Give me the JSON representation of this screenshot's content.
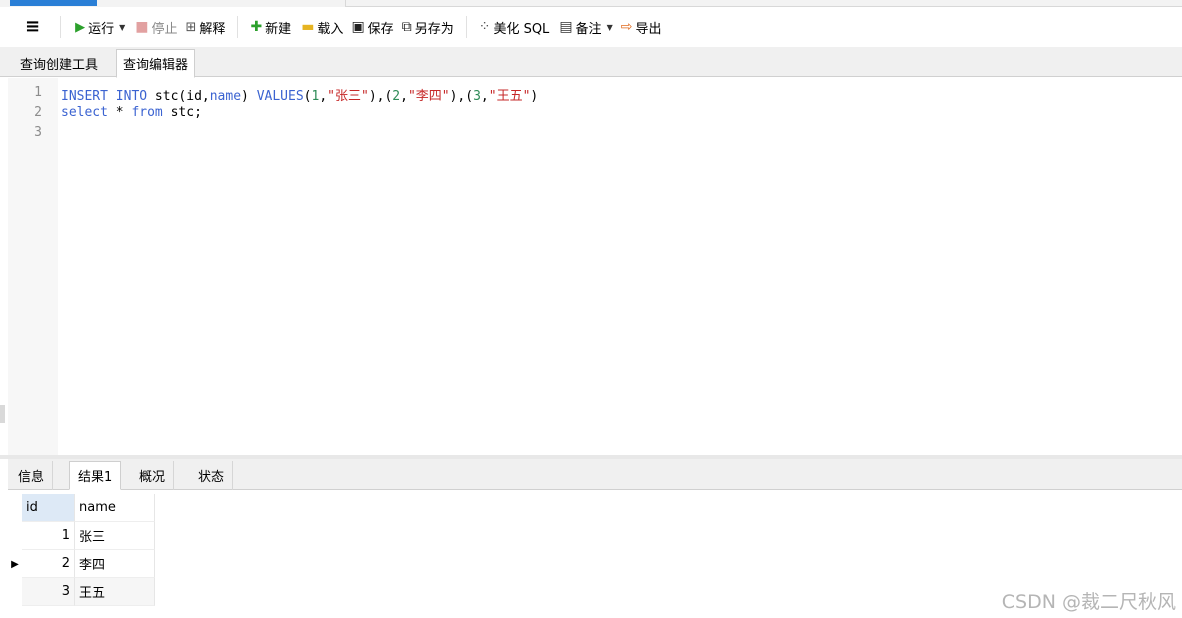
{
  "toolbar": {
    "menu_icon": "hamburger-menu-icon",
    "run_label": "运行",
    "stop_label": "停止",
    "explain_label": "解释",
    "new_label": "新建",
    "load_label": "载入",
    "save_label": "保存",
    "saveas_label": "另存为",
    "beautify_label": "美化 SQL",
    "note_label": "备注",
    "export_label": "导出"
  },
  "tabs": {
    "builder": "查询创建工具",
    "editor": "查询编辑器"
  },
  "editor": {
    "line_numbers": [
      "1",
      "2",
      "3"
    ],
    "line1": {
      "k1": "INSERT",
      "k2": "INTO",
      "p1": " stc(id,",
      "k3": "name",
      "p2": ") ",
      "k4": "VALUES",
      "p3": "(",
      "n1": "1",
      "p4": ",",
      "s1": "\"张三\"",
      "p5": "),(",
      "n2": "2",
      "p6": ",",
      "s2": "\"李四\"",
      "p7": "),(",
      "n3": "3",
      "p8": ",",
      "s3": "\"王五\"",
      "p9": ")"
    },
    "line2": {
      "k1": "select",
      "p1": " * ",
      "k2": "from",
      "p2": " stc;"
    }
  },
  "result_tabs": [
    "信息",
    "结果1",
    "概况",
    "状态"
  ],
  "grid": {
    "columns": [
      "id",
      "name"
    ],
    "rows": [
      {
        "id": "1",
        "name": "张三"
      },
      {
        "id": "2",
        "name": "李四"
      },
      {
        "id": "3",
        "name": "王五"
      }
    ],
    "current_row_marker": "▶"
  },
  "watermark": "CSDN @裁二尺秋风",
  "colors": {
    "keyword": "#3b63d1",
    "string": "#c62828",
    "number": "#2e8b57",
    "run_icon": "#2ca02c",
    "header_id_bg": "#dde9f6"
  }
}
